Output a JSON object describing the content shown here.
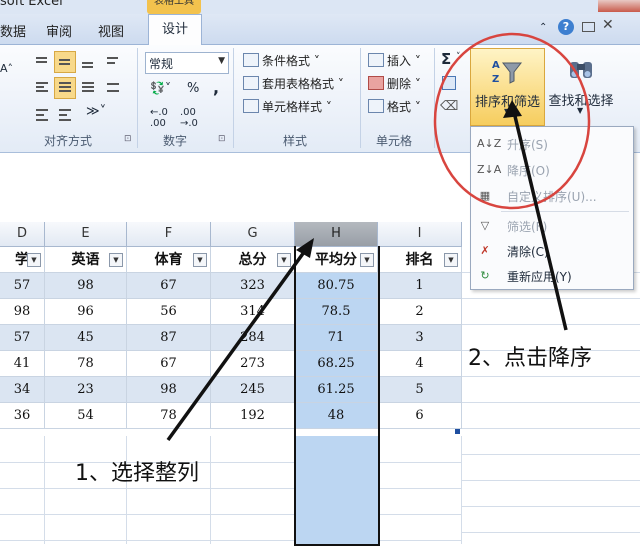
{
  "titlebar": {
    "title": "soft Excel",
    "contextual_label": "表格工具"
  },
  "tabs": [
    "数据",
    "审阅",
    "视图",
    "设计"
  ],
  "ribbon": {
    "alignment_group": "对齐方式",
    "number_group": "数字",
    "number_format": "常规",
    "currency": "%",
    "comma": ",",
    "styles_group": "样式",
    "styles": [
      "条件格式",
      "套用表格格式",
      "单元格样式"
    ],
    "cells_group": "单元格",
    "cells": [
      "插入",
      "删除",
      "格式"
    ],
    "sigma": "Σ",
    "sort_filter": "排序和筛选",
    "find_select": "查找和选择"
  },
  "sort_menu": {
    "items": [
      {
        "label": "升序(S)",
        "enabled": false
      },
      {
        "label": "降序(O)",
        "enabled": false
      },
      {
        "label": "自定义排序(U)...",
        "enabled": false
      },
      {
        "label": "筛选(F)",
        "enabled": false
      },
      {
        "label": "清除(C)",
        "enabled": true
      },
      {
        "label": "重新应用(Y)",
        "enabled": true
      }
    ]
  },
  "sheet": {
    "columns": [
      "D",
      "E",
      "F",
      "G",
      "H",
      "I"
    ],
    "selected_column": "H",
    "headers": [
      "学",
      "英语",
      "体育",
      "总分",
      "平均分",
      "排名"
    ],
    "rows": [
      [
        "57",
        "98",
        "67",
        "323",
        "80.75",
        "1"
      ],
      [
        "98",
        "96",
        "56",
        "314",
        "78.5",
        "2"
      ],
      [
        "57",
        "45",
        "87",
        "284",
        "71",
        "3"
      ],
      [
        "41",
        "78",
        "67",
        "273",
        "68.25",
        "4"
      ],
      [
        "34",
        "23",
        "98",
        "245",
        "61.25",
        "5"
      ],
      [
        "36",
        "54",
        "78",
        "192",
        "48",
        "6"
      ]
    ]
  },
  "annotations": {
    "step1": "1、选择整列",
    "step2": "2、点击降序"
  }
}
